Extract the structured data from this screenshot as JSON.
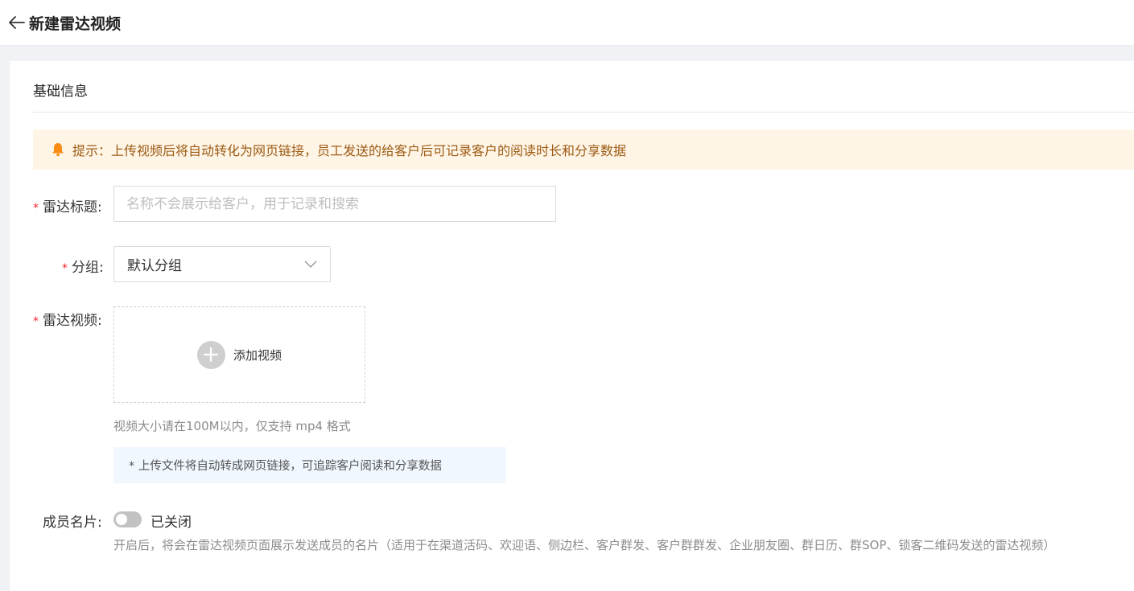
{
  "header": {
    "back_icon": "arrow-left-icon",
    "title": "新建雷达视频"
  },
  "section": {
    "title": "基础信息"
  },
  "notice": {
    "icon": "bell-icon",
    "color": "#fa8c16",
    "text": "提示：上传视频后将自动转化为网页链接，员工发送的给客户后可记录客户的阅读时长和分享数据"
  },
  "form": {
    "required_mark": "*",
    "title_field": {
      "label": "雷达标题:",
      "value": "",
      "placeholder": "名称不会展示给客户，用于记录和搜索"
    },
    "group_field": {
      "label": "分组:",
      "value": "默认分组"
    },
    "video_field": {
      "label": "雷达视频:",
      "upload_label": "添加视频",
      "hint": "视频大小请在100M以内，仅支持 mp4 格式",
      "info": "* 上传文件将自动转成网页链接，可追踪客户阅读和分享数据"
    },
    "card_field": {
      "label": "成员名片:",
      "state": "已关闭",
      "enabled": false,
      "description": "开启后，将会在雷达视频页面展示发送成员的名片（适用于在渠道活码、欢迎语、侧边栏、客户群发、客户群群发、企业朋友圈、群日历、群SOP、锁客二维码发送的雷达视频）"
    }
  },
  "colors": {
    "required": "#f5222d",
    "notice_bg": "#fff5e6",
    "info_bg": "#f0f7ff"
  }
}
